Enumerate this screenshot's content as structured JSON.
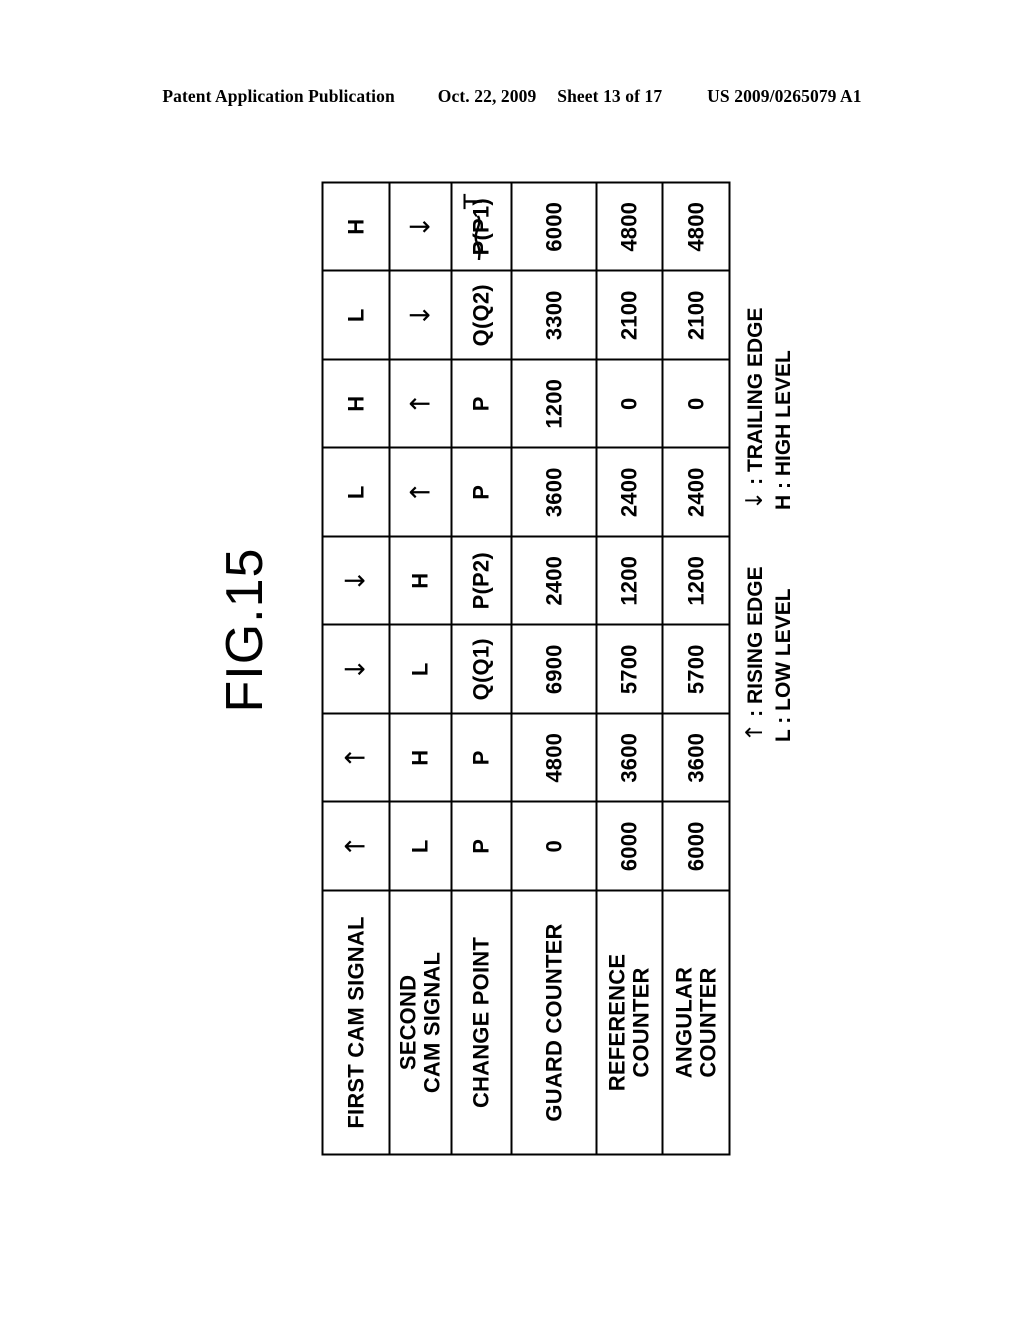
{
  "header": {
    "publication": "Patent Application Publication",
    "date": "Oct. 22, 2009",
    "sheet": "Sheet 13 of 17",
    "patent_number": "US 2009/0265079 A1"
  },
  "figure": {
    "label": "FIG.15",
    "callout": "T"
  },
  "table": {
    "rows": [
      {
        "label": "FIRST CAM SIGNAL",
        "label_lines": [
          "FIRST CAM SIGNAL"
        ],
        "cells": [
          "↑",
          "↑",
          "↓",
          "↓",
          "L",
          "H",
          "L",
          "H"
        ]
      },
      {
        "label": "SECOND CAM SIGNAL",
        "label_lines": [
          "SECOND",
          "CAM SIGNAL"
        ],
        "cells": [
          "L",
          "H",
          "L",
          "H",
          "↑",
          "↑",
          "↓",
          "↓"
        ]
      },
      {
        "label": "CHANGE POINT",
        "label_lines": [
          "CHANGE POINT"
        ],
        "cells": [
          "P",
          "P",
          "Q(Q1)",
          "P(P2)",
          "P",
          "P",
          "Q(Q2)",
          "P(P1)"
        ]
      },
      {
        "label": "GUARD COUNTER",
        "label_lines": [
          "GUARD COUNTER"
        ],
        "cells": [
          "0",
          "4800",
          "6900",
          "2400",
          "3600",
          "1200",
          "3300",
          "6000"
        ]
      },
      {
        "label": "REFERENCE COUNTER",
        "label_lines": [
          "REFERENCE",
          "COUNTER"
        ],
        "cells": [
          "6000",
          "3600",
          "5700",
          "1200",
          "2400",
          "0",
          "2100",
          "4800"
        ]
      },
      {
        "label": "ANGULAR COUNTER",
        "label_lines": [
          "ANGULAR",
          "COUNTER"
        ],
        "cells": [
          "6000",
          "3600",
          "5700",
          "1200",
          "2400",
          "0",
          "2100",
          "4800"
        ]
      }
    ]
  },
  "legend": {
    "rising": ": RISING EDGE",
    "rising_glyph": "↑",
    "low": "L : LOW LEVEL",
    "trailing": ": TRAILING EDGE",
    "trailing_glyph": "↓",
    "high": "H : HIGH LEVEL"
  }
}
